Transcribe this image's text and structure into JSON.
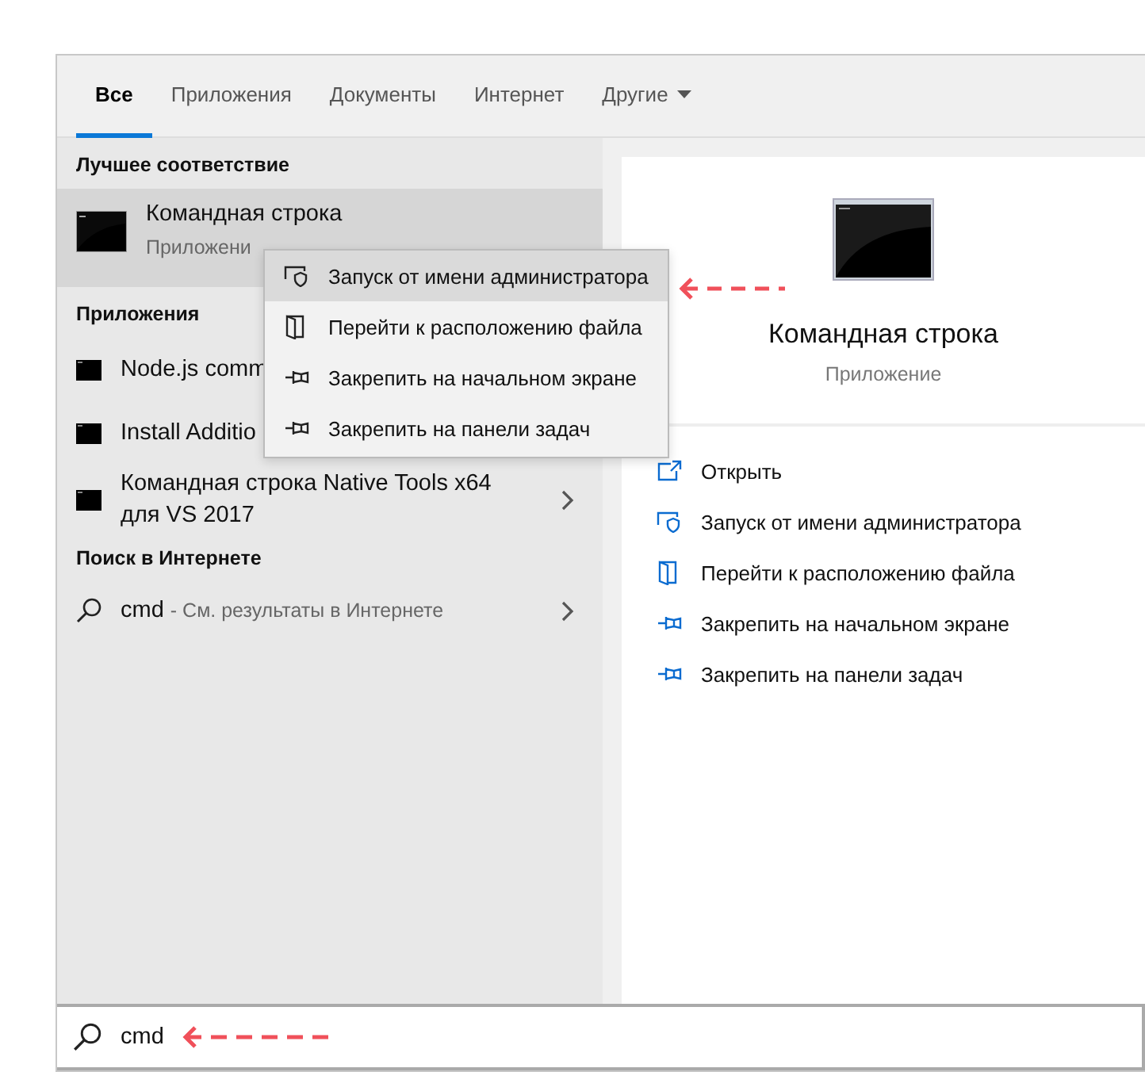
{
  "tabs": [
    {
      "label": "Все",
      "selected": true,
      "dropdown": false
    },
    {
      "label": "Приложения",
      "selected": false,
      "dropdown": false
    },
    {
      "label": "Документы",
      "selected": false,
      "dropdown": false
    },
    {
      "label": "Интернет",
      "selected": false,
      "dropdown": false
    },
    {
      "label": "Другие",
      "selected": false,
      "dropdown": true
    }
  ],
  "best_match": {
    "heading": "Лучшее соответствие",
    "title": "Командная строка",
    "subtitle": "Приложени",
    "selected": true
  },
  "apps": {
    "heading": "Приложения",
    "items": [
      {
        "name": "Node.js comm"
      },
      {
        "name": "Install Additio"
      },
      {
        "name": "Командная строка Native Tools x64 для VS 2017",
        "has_arrow": true
      }
    ]
  },
  "web": {
    "heading": "Поиск в Интернете",
    "query": "cmd",
    "hint": "- См. результаты в Интернете"
  },
  "context_menu": [
    {
      "label": "Запуск от имени администратора",
      "kind": "shield",
      "selected": true
    },
    {
      "label": "Перейти к расположению файла",
      "kind": "folder",
      "selected": false
    },
    {
      "label": "Закрепить на начальном экране",
      "kind": "pin",
      "selected": false
    },
    {
      "label": "Закрепить на панели задач",
      "kind": "pin",
      "selected": false
    }
  ],
  "preview": {
    "title": "Командная строка",
    "subtitle": "Приложение",
    "actions": [
      {
        "label": "Открыть",
        "kind": "open"
      },
      {
        "label": "Запуск от имени администратора",
        "kind": "shield"
      },
      {
        "label": "Перейти к расположению файла",
        "kind": "folder"
      },
      {
        "label": "Закрепить на начальном экране",
        "kind": "pin"
      },
      {
        "label": "Закрепить на панели задач",
        "kind": "pin"
      }
    ]
  },
  "search": {
    "value": "cmd"
  }
}
